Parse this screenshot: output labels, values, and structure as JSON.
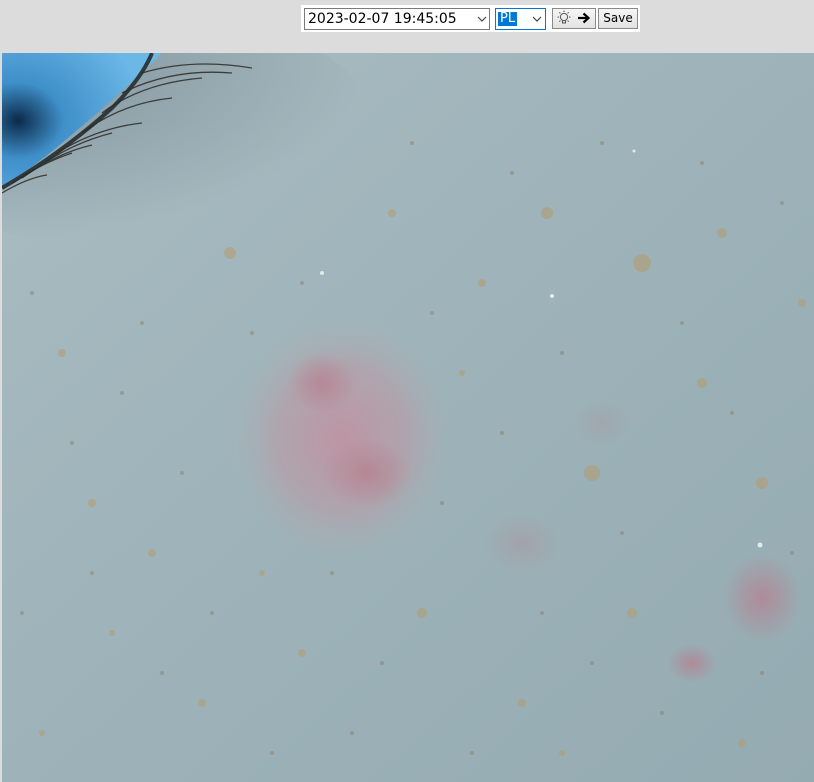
{
  "toolbar": {
    "datetime_value": "2023-02-07 19:45:05",
    "mode_value": "PL",
    "light_icon": "light-bulb-icon",
    "arrow_icon": "arrow-right-icon",
    "save_label": "Save"
  },
  "viewer": {
    "content": "skin-closeup-camera-image"
  },
  "colors": {
    "toolbar_bg": "#dcdcdc",
    "select_focus": "#0078d7",
    "skin_base": "#9eb3b8"
  }
}
